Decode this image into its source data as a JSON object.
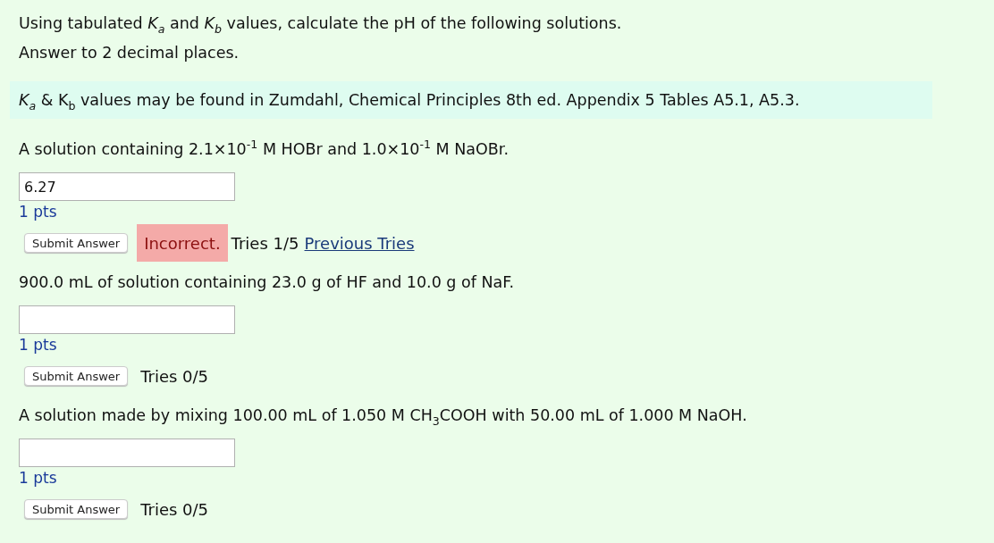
{
  "intro": [
    "Using tabulated *K$_{a}$* and *K$_{b}$* values, calculate the pH of the following solutions.",
    "Answer to 2 decimal places."
  ],
  "note": "*K$_{a}$* & K$_{b}$ values may be found in Zumdahl, Chemical Principles 8th ed. Appendix 5 Tables A5.1, A5.3.",
  "questions": [
    {
      "text": "A solution containing 2.1×10$^{-1}$ M HOBr and 1.0×10$^{-1}$ M NaOBr.",
      "value": "6.27",
      "points": "1 pts",
      "button": "Submit Answer",
      "status": {
        "kind": "incorrect",
        "label": "Incorrect."
      },
      "tries": "Tries 1/5",
      "link": "Previous Tries"
    },
    {
      "text": "900.0 mL of solution containing 23.0 g of HF and 10.0 g of NaF.",
      "points": "1 pts",
      "button": "Submit Answer",
      "tries": "Tries 0/5"
    },
    {
      "text": "A solution made by mixing 100.00 mL of 1.050 M CH$_{3}$COOH with 50.00 mL of 1.000 M NaOH.",
      "points": "1 pts",
      "button": "Submit Answer",
      "tries": "Tries 0/5"
    }
  ]
}
